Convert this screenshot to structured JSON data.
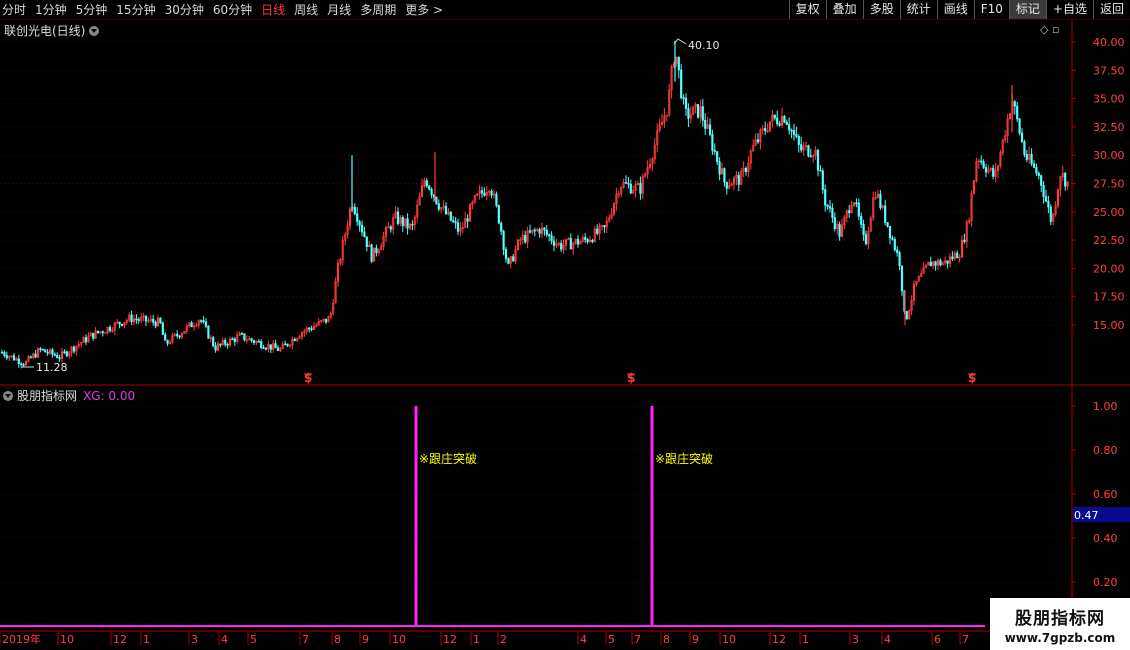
{
  "toolbar": {
    "periods": [
      {
        "label": "分时",
        "active": false
      },
      {
        "label": "1分钟",
        "active": false
      },
      {
        "label": "5分钟",
        "active": false
      },
      {
        "label": "15分钟",
        "active": false
      },
      {
        "label": "30分钟",
        "active": false
      },
      {
        "label": "60分钟",
        "active": false
      },
      {
        "label": "日线",
        "active": true
      },
      {
        "label": "周线",
        "active": false
      },
      {
        "label": "月线",
        "active": false
      },
      {
        "label": "多周期",
        "active": false
      },
      {
        "label": "更多 >",
        "active": false
      }
    ],
    "actions": [
      "复权",
      "叠加",
      "多股",
      "统计",
      "画线",
      "F10",
      "标记",
      "+自选",
      "返回"
    ]
  },
  "price_panel": {
    "title": "联创光电(日线)",
    "y_ticks": [
      "40.00",
      "37.50",
      "35.00",
      "32.50",
      "30.00",
      "27.50",
      "25.00",
      "22.50",
      "20.00",
      "17.50",
      "15.00"
    ],
    "max_label": "40.10",
    "min_label": "11.28",
    "signal_marker": "$"
  },
  "indicator_panel": {
    "name": "股朋指标网",
    "xg_label": "XG: 0.00",
    "y_ticks": [
      "1.00",
      "0.80",
      "0.60",
      "0.40",
      "0.20"
    ],
    "cursor_value": "0.47",
    "signal_text": "※跟庄突破"
  },
  "x_axis": {
    "labels": [
      "2019年",
      "10",
      "12",
      "1",
      "3",
      "4",
      "5",
      "7",
      "8",
      "9",
      "10",
      "12",
      "1",
      "2",
      "4",
      "5",
      "7",
      "8",
      "9",
      "10",
      "12",
      "1",
      "3",
      "4",
      "6",
      "7"
    ]
  },
  "watermark": {
    "title": "股朋指标网",
    "url": "www.7gpzb.com"
  },
  "colors": {
    "up": "#ff3b3b",
    "down": "#54ffff",
    "signal": "#ff22ff",
    "label_yellow": "#ffff00",
    "axis_red": "#b00000"
  }
}
